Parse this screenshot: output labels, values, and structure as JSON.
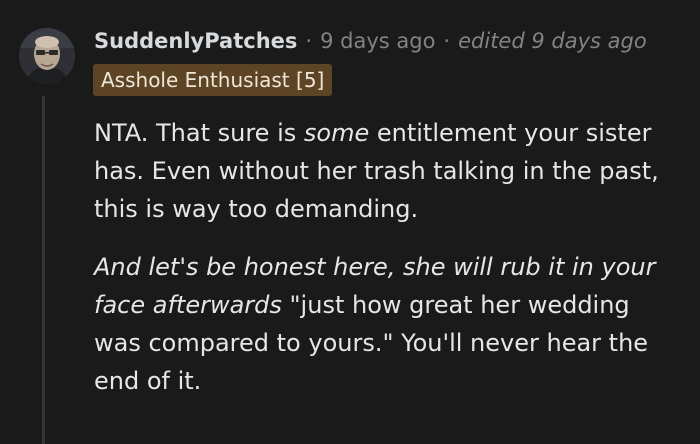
{
  "comment": {
    "author": "SuddenlyPatches",
    "separator": "·",
    "posted": "9 days ago",
    "edited": "edited 9 days ago",
    "flair": "Asshole Enthusiast [5]",
    "avatar_icon": "user-avatar-icon",
    "p1_before": "NTA. That sure is ",
    "p1_em": "some",
    "p1_after": " entitlement your sister has. Even without her trash talking in the past, this is way too demanding.",
    "p2_em": "And let's be honest here, she will rub it in your face afterwards",
    "p2_after": " \"just how great her wedding was compared to yours.\" You'll never hear the end of it."
  },
  "colors": {
    "background": "#1a1a1b",
    "text": "#d7dadc",
    "meta": "#818384",
    "flair_bg": "#5c4425",
    "thread_line": "#343536"
  }
}
